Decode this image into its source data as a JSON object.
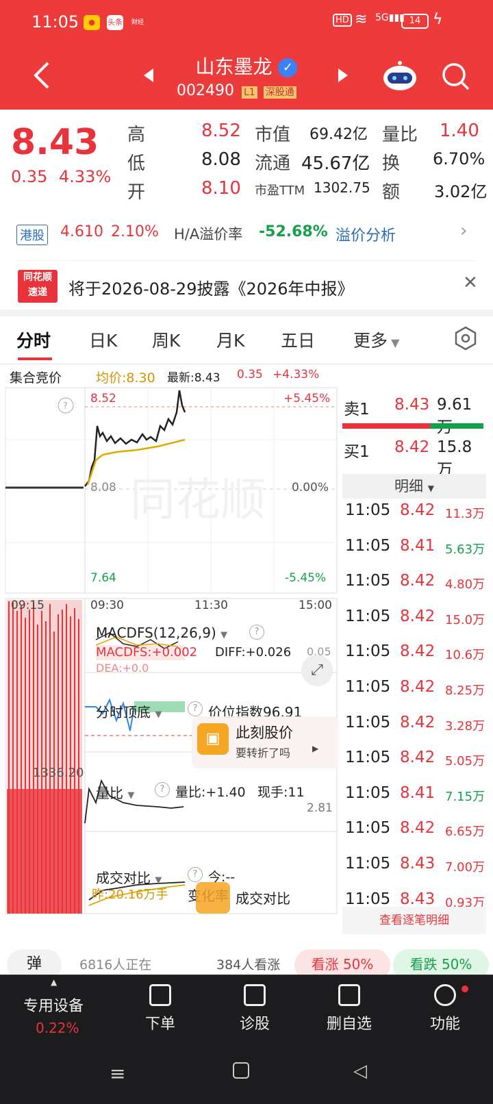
{
  "status": {
    "time": "11:05",
    "apps": [
      "头条",
      "财经"
    ],
    "network": "HD 5G",
    "battery": "14"
  },
  "header": {
    "stock_name": "山东墨龙",
    "code": "002490",
    "tags": [
      "L1",
      "深股通"
    ]
  },
  "quote": {
    "price": "8.43",
    "change": "0.35",
    "change_pct": "4.33%",
    "high_label": "高",
    "high": "8.52",
    "low_label": "低",
    "low": "8.08",
    "open_label": "开",
    "open": "8.10",
    "mcap_label": "市值",
    "mcap": "69.42亿",
    "float_label": "流通",
    "float": "45.67亿",
    "pe_label": "市盈TTM",
    "pe": "1302.75",
    "vr_label": "量比",
    "vr": "1.40",
    "turn_label": "换",
    "turn": "6.70%",
    "amt_label": "额",
    "amt": "3.02亿"
  },
  "hk": {
    "tag": "港股",
    "price": "4.610",
    "pct": "2.10%",
    "ha_label": "H/A溢价率",
    "ha": "-52.68%",
    "link": "溢价分析"
  },
  "news": {
    "logo_top": "同花顺",
    "logo_bottom": "速递",
    "text": "将于2026-08-29披露《2026年中报》"
  },
  "tabs": [
    "分时",
    "日K",
    "周K",
    "月K",
    "五日",
    "更多"
  ],
  "chart": {
    "auction": "集合竞价",
    "avg": "均价:8.30",
    "latest": "最新:8.43",
    "chg": "0.35",
    "pct": "+4.33%",
    "top": "8.52",
    "top_pct": "+5.45%",
    "mid": "8.08",
    "mid_pct": "0.00%",
    "bot": "7.64",
    "bot_pct": "-5.45%",
    "times": [
      "09:15",
      "09:30",
      "11:30",
      "15:00"
    ],
    "watermark": "同花顺",
    "macd_title": "MACDFS(12,26,9)",
    "macd_val": "MACDFS:+0.002",
    "diff": "DIFF:+0.026",
    "macd_right": "0.05",
    "dea": "DEA:+0.0",
    "td_title": "分时顶底",
    "td_val": "价位指数96.91",
    "promo_title": "此刻股价",
    "promo_sub": "要转折了吗",
    "vr_title": "量比",
    "vr_val": "量比:+1.40",
    "now_hand": "现手:11",
    "vr_right": "2.81",
    "left_vol": "1336.20",
    "cv_title": "成交对比",
    "cv_today": "今:--",
    "cv_yest": "昨:20.16万手",
    "cv_change": "变化率",
    "cv_promo": "成交对比"
  },
  "book": {
    "sell_label": "卖1",
    "sell_price": "8.43",
    "sell_vol": "9.61万",
    "buy_label": "买1",
    "buy_price": "8.42",
    "buy_vol": "15.8万",
    "detail": "明细"
  },
  "ticks": [
    {
      "t": "11:05",
      "p": "8.42",
      "v": "11.3万",
      "c": "red"
    },
    {
      "t": "11:05",
      "p": "8.41",
      "v": "5.63万",
      "c": "green"
    },
    {
      "t": "11:05",
      "p": "8.42",
      "v": "4.80万",
      "c": "red"
    },
    {
      "t": "11:05",
      "p": "8.42",
      "v": "15.0万",
      "c": "red"
    },
    {
      "t": "11:05",
      "p": "8.42",
      "v": "10.6万",
      "c": "red"
    },
    {
      "t": "11:05",
      "p": "8.42",
      "v": "8.25万",
      "c": "red"
    },
    {
      "t": "11:05",
      "p": "8.42",
      "v": "3.28万",
      "c": "red"
    },
    {
      "t": "11:05",
      "p": "8.42",
      "v": "5.05万",
      "c": "red"
    },
    {
      "t": "11:05",
      "p": "8.41",
      "v": "7.15万",
      "c": "green"
    },
    {
      "t": "11:05",
      "p": "8.42",
      "v": "6.65万",
      "c": "red"
    },
    {
      "t": "11:05",
      "p": "8.43",
      "v": "7.00万",
      "c": "red"
    },
    {
      "t": "11:05",
      "p": "8.43",
      "v": "0.93万",
      "c": "red"
    }
  ],
  "tick_link": "查看逐笔明细",
  "community": {
    "bullet": "弹",
    "watching": "6816人正在",
    "bearish": "384人看涨",
    "up": "看涨 50%",
    "down": "看跌 50%"
  },
  "bottom": {
    "device": "专用设备",
    "device_pct": "0.22%",
    "order": "下单",
    "diag": "诊股",
    "del": "删自选",
    "func": "功能"
  },
  "colors": {
    "red": "#e8333b",
    "green": "#14a14a",
    "header": "#ed3b3b",
    "avg_line": "#e0a800"
  }
}
